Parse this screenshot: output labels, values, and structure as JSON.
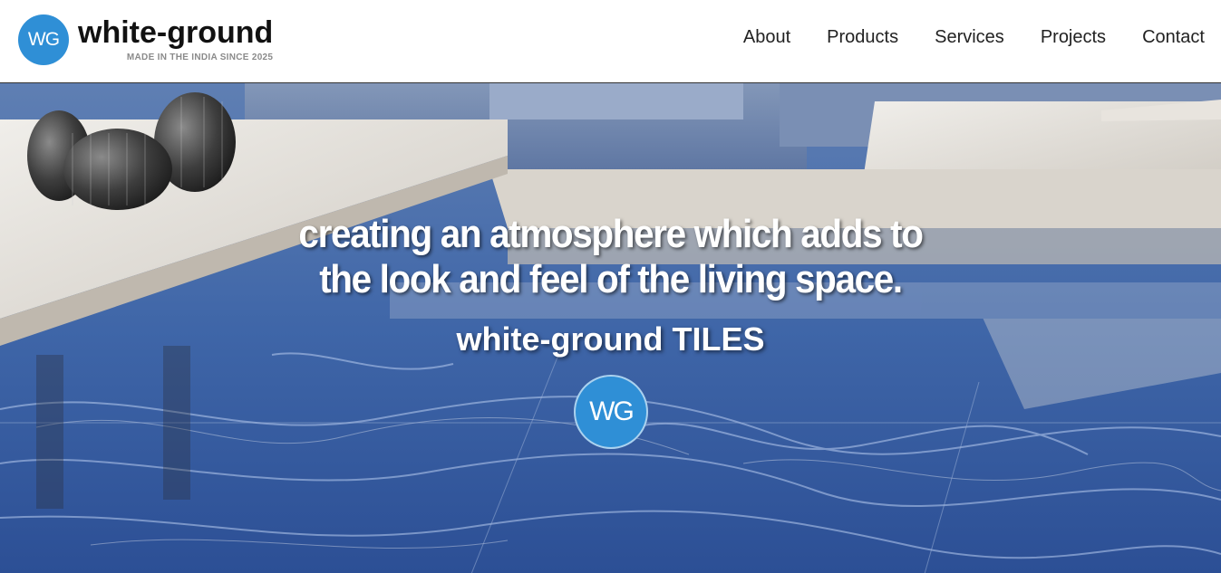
{
  "brand": {
    "badge_text": "WG",
    "name": "white-ground",
    "tagline": "MADE IN THE INDIA SINCE 2025",
    "color": "#2f8fd6"
  },
  "nav": {
    "items": [
      {
        "label": "About"
      },
      {
        "label": "Products"
      },
      {
        "label": "Services"
      },
      {
        "label": "Projects"
      },
      {
        "label": "Contact"
      }
    ]
  },
  "hero": {
    "headline_line1": "creating an atmosphere which adds to",
    "headline_line2": "the look and feel of the living space.",
    "subtitle": "white-ground TILES",
    "badge_text": "WG",
    "image": "living-room-blue-marble-tiles"
  }
}
